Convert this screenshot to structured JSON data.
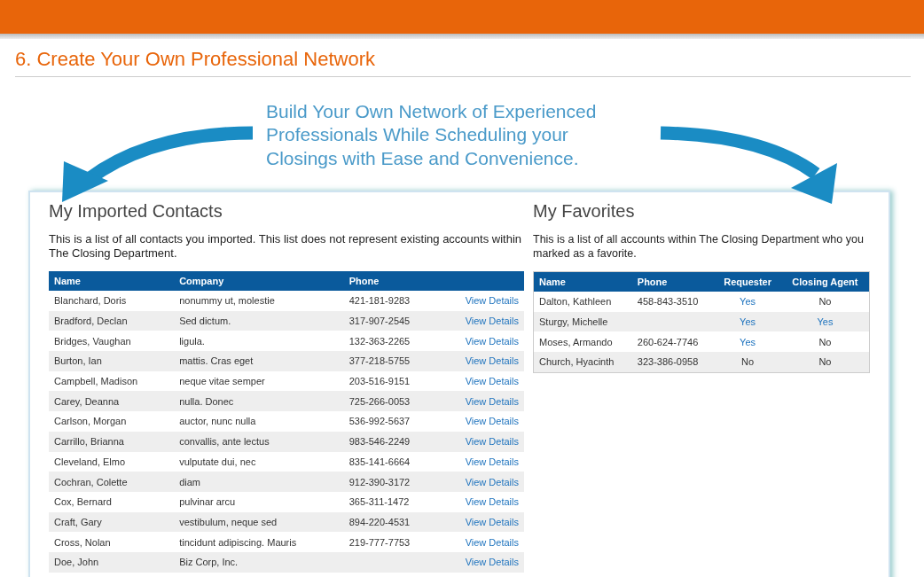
{
  "section_title": "6. Create Your Own Professional Network",
  "callout": "Build Your Own Network of Experienced Professionals While Scheduling your Closings with Ease and Convenience.",
  "contacts": {
    "title": "My Imported Contacts",
    "description": "This is a list of all contacts you imported. This list does not represent existing accounts within The Closing Department.",
    "columns": [
      "Name",
      "Company",
      "Phone"
    ],
    "rows": [
      {
        "name": "Blanchard, Doris",
        "company": "nonummy ut, molestie",
        "phone": "421-181-9283",
        "link": "View Details"
      },
      {
        "name": "Bradford, Declan",
        "company": "Sed dictum.",
        "phone": "317-907-2545",
        "link": "View Details"
      },
      {
        "name": "Bridges, Vaughan",
        "company": "ligula.",
        "phone": "132-363-2265",
        "link": "View Details"
      },
      {
        "name": "Burton, Ian",
        "company": "mattis. Cras eget",
        "phone": "377-218-5755",
        "link": "View Details"
      },
      {
        "name": "Campbell, Madison",
        "company": "neque vitae semper",
        "phone": "203-516-9151",
        "link": "View Details"
      },
      {
        "name": "Carey, Deanna",
        "company": "nulla. Donec",
        "phone": "725-266-0053",
        "link": "View Details"
      },
      {
        "name": "Carlson, Morgan",
        "company": "auctor, nunc nulla",
        "phone": "536-992-5637",
        "link": "View Details"
      },
      {
        "name": "Carrillo, Brianna",
        "company": "convallis, ante lectus",
        "phone": "983-546-2249",
        "link": "View Details"
      },
      {
        "name": "Cleveland, Elmo",
        "company": "vulputate dui, nec",
        "phone": "835-141-6664",
        "link": "View Details"
      },
      {
        "name": "Cochran, Colette",
        "company": "diam",
        "phone": "912-390-3172",
        "link": "View Details"
      },
      {
        "name": "Cox, Bernard",
        "company": "pulvinar arcu",
        "phone": "365-311-1472",
        "link": "View Details"
      },
      {
        "name": "Craft, Gary",
        "company": "vestibulum, neque sed",
        "phone": "894-220-4531",
        "link": "View Details"
      },
      {
        "name": "Cross, Nolan",
        "company": "tincidunt adipiscing. Mauris",
        "phone": "219-777-7753",
        "link": "View Details"
      },
      {
        "name": "Doe, John",
        "company": "Biz Corp, Inc.",
        "phone": "",
        "link": "View Details"
      }
    ]
  },
  "favorites": {
    "title": "My Favorites",
    "description": "This is a list of all accounts within The Closing Department who you marked as a favorite.",
    "columns": [
      "Name",
      "Phone",
      "Requester",
      "Closing Agent"
    ],
    "rows": [
      {
        "name": "Dalton, Kathleen",
        "phone": "458-843-3510",
        "requester": {
          "text": "Yes",
          "link": true
        },
        "closing_agent": {
          "text": "No",
          "link": false
        }
      },
      {
        "name": "Sturgy, Michelle",
        "phone": "",
        "requester": {
          "text": "Yes",
          "link": true
        },
        "closing_agent": {
          "text": "Yes",
          "link": true
        }
      },
      {
        "name": "Moses, Armando",
        "phone": "260-624-7746",
        "requester": {
          "text": "Yes",
          "link": true
        },
        "closing_agent": {
          "text": "No",
          "link": false
        }
      },
      {
        "name": "Church, Hyacinth",
        "phone": "323-386-0958",
        "requester": {
          "text": "No",
          "link": false
        },
        "closing_agent": {
          "text": "No",
          "link": false
        }
      }
    ]
  }
}
